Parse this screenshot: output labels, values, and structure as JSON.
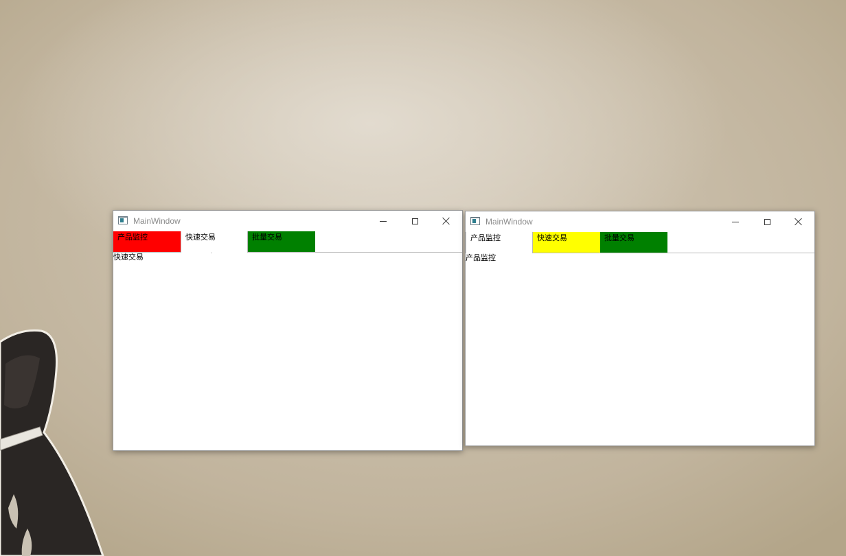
{
  "windows": [
    {
      "title": "MainWindow",
      "controls": [
        "minimize-icon",
        "maximize-icon",
        "close-icon"
      ],
      "tabs": [
        {
          "label": "产品监控",
          "color": "#ff0000",
          "selected": false
        },
        {
          "label": "快速交易",
          "color": "#ffffff",
          "selected": true
        },
        {
          "label": "批量交易",
          "color": "#008000",
          "selected": false
        }
      ],
      "content_text": "快速交易"
    },
    {
      "title": "MainWindow",
      "controls": [
        "minimize-icon",
        "maximize-icon",
        "close-icon"
      ],
      "tabs": [
        {
          "label": "产品监控",
          "color": "#ffffff",
          "selected": true
        },
        {
          "label": "快速交易",
          "color": "#ffff00",
          "selected": false
        },
        {
          "label": "批量交易",
          "color": "#008000",
          "selected": false
        }
      ],
      "content_text": "产品监控"
    }
  ]
}
